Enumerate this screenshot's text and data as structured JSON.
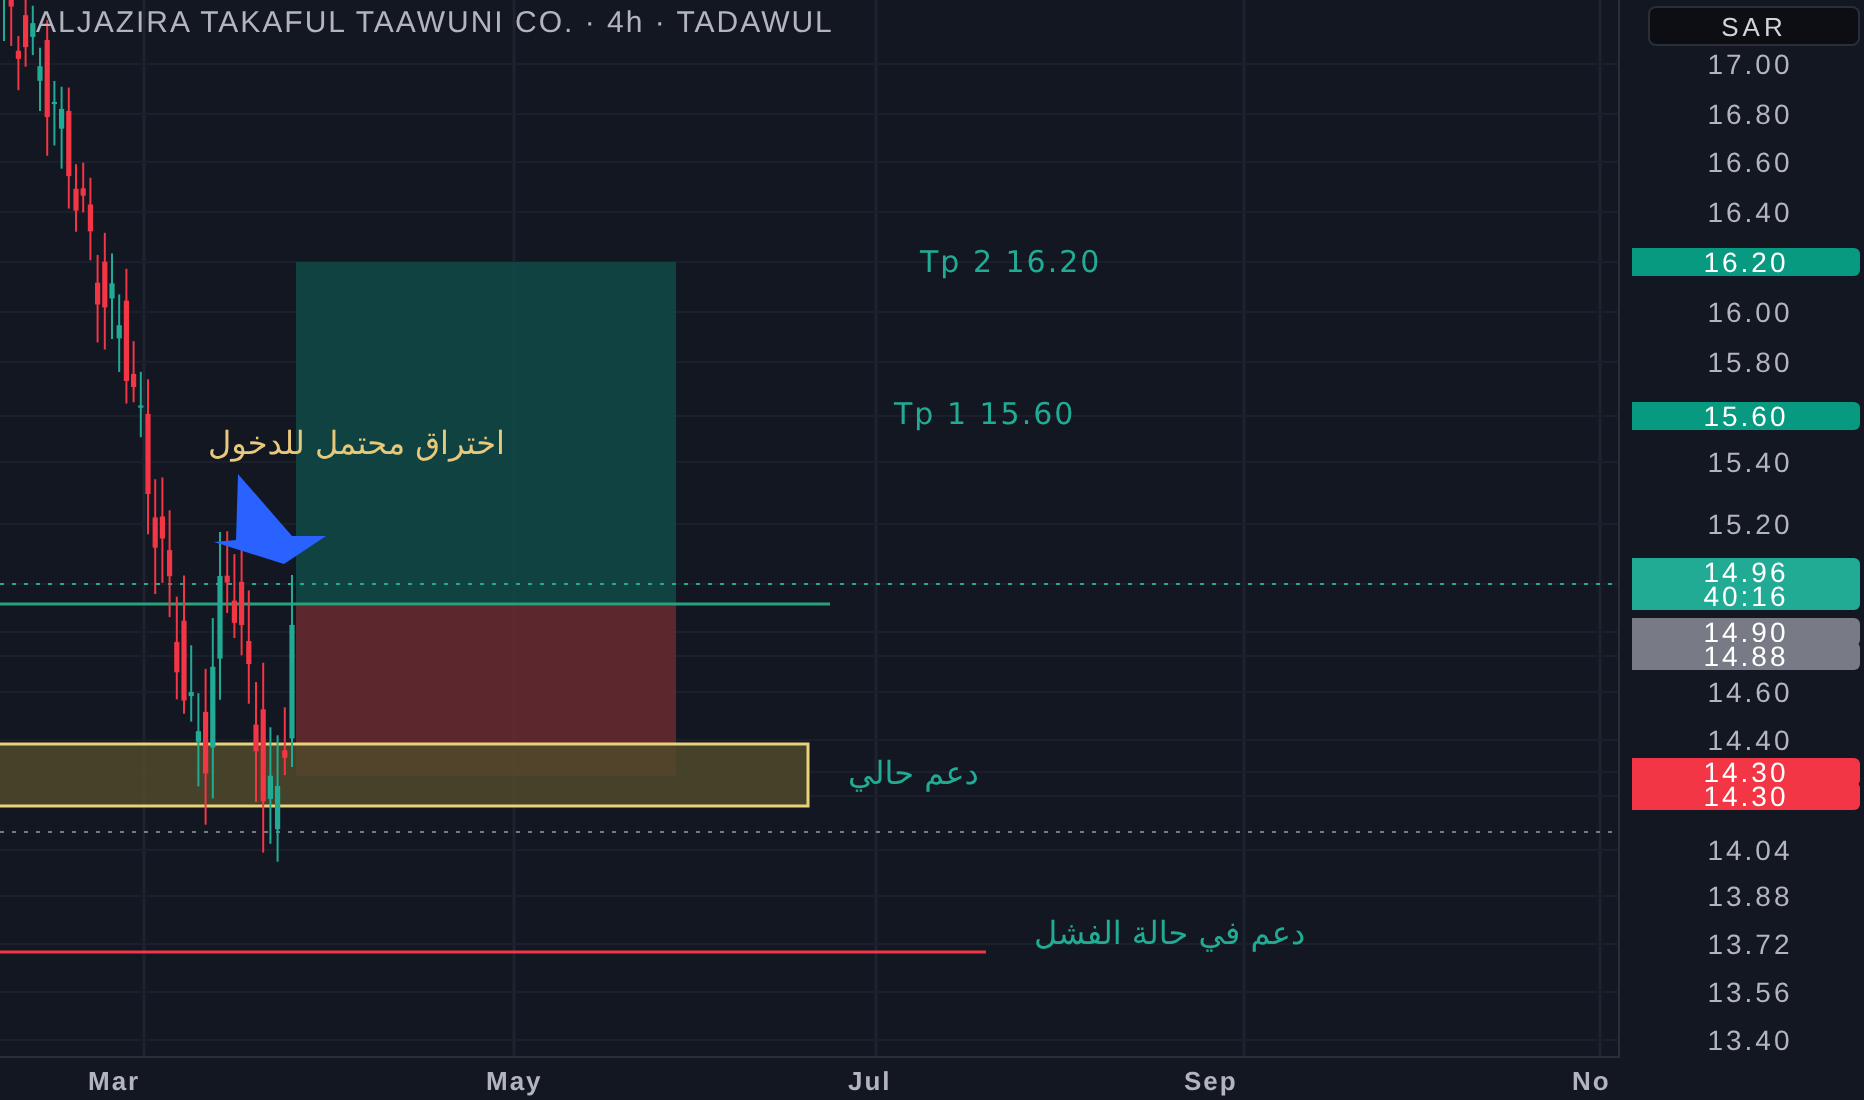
{
  "title": "ALJAZIRA TAKAFUL TAAWUNI CO. · 4h · TADAWUL",
  "currency_button": "SAR",
  "annotations": [
    {
      "kind": "entry",
      "text": "اختراق محتمل للدخول"
    },
    {
      "kind": "target",
      "text": "Tp 2 16.20"
    },
    {
      "kind": "target",
      "text": "Tp 1 15.60"
    },
    {
      "kind": "support",
      "text": "دعم حالي"
    },
    {
      "kind": "support",
      "text": "دعم في حالة الفشل"
    }
  ],
  "price_axis": [
    {
      "kind": "tick",
      "text": "17.00"
    },
    {
      "kind": "tick",
      "text": "16.80"
    },
    {
      "kind": "tick",
      "text": "16.60"
    },
    {
      "kind": "tick",
      "text": "16.40"
    },
    {
      "kind": "badge",
      "text": "16.20",
      "color": "#089981"
    },
    {
      "kind": "tick",
      "text": "16.00"
    },
    {
      "kind": "tick",
      "text": "15.80"
    },
    {
      "kind": "badge",
      "text": "15.60",
      "color": "#089981"
    },
    {
      "kind": "tick",
      "text": "15.40"
    },
    {
      "kind": "tick",
      "text": "15.20"
    },
    {
      "kind": "badge",
      "text": "14.96",
      "sub": "40:16",
      "color": "#22ab94"
    },
    {
      "kind": "badge",
      "text": "14.90",
      "color": "#787b86"
    },
    {
      "kind": "badge",
      "text": "14.88",
      "color": "#787b86"
    },
    {
      "kind": "tick",
      "text": "14.60"
    },
    {
      "kind": "tick",
      "text": "14.40"
    },
    {
      "kind": "badge",
      "text": "14.30",
      "color": "#f23645"
    },
    {
      "kind": "badge",
      "text": "14.30",
      "color": "#f23645"
    },
    {
      "kind": "tick",
      "text": "14.04"
    },
    {
      "kind": "tick",
      "text": "13.88"
    },
    {
      "kind": "tick",
      "text": "13.72"
    },
    {
      "kind": "tick",
      "text": "13.56"
    },
    {
      "kind": "tick",
      "text": "13.40"
    }
  ],
  "time_axis": [
    "Mar",
    "May",
    "Jul",
    "Sep",
    "No"
  ]
}
